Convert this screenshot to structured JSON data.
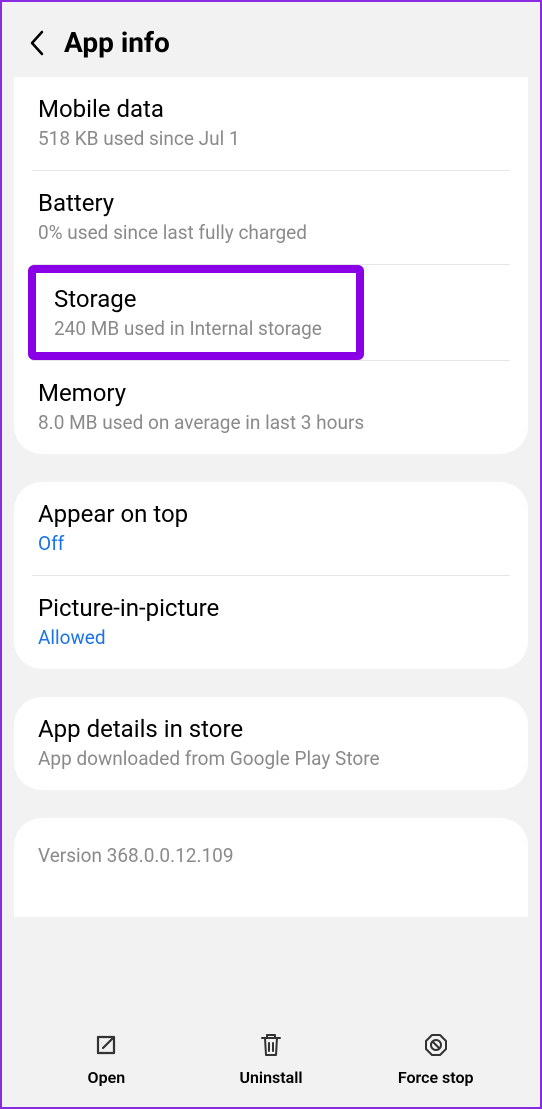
{
  "header": {
    "title": "App info"
  },
  "usage": {
    "mobile_data": {
      "title": "Mobile data",
      "sub": "518 KB used since Jul 1"
    },
    "battery": {
      "title": "Battery",
      "sub": "0% used since last fully charged"
    },
    "storage": {
      "title": "Storage",
      "sub": "240 MB used in Internal storage"
    },
    "memory": {
      "title": "Memory",
      "sub": "8.0 MB used on average in last 3 hours"
    }
  },
  "display": {
    "appear_on_top": {
      "title": "Appear on top",
      "status": "Off"
    },
    "pip": {
      "title": "Picture-in-picture",
      "status": "Allowed"
    }
  },
  "store": {
    "title": "App details in store",
    "sub": "App downloaded from Google Play Store"
  },
  "version": "Version 368.0.0.12.109",
  "bottom": {
    "open": "Open",
    "uninstall": "Uninstall",
    "force_stop": "Force stop"
  }
}
